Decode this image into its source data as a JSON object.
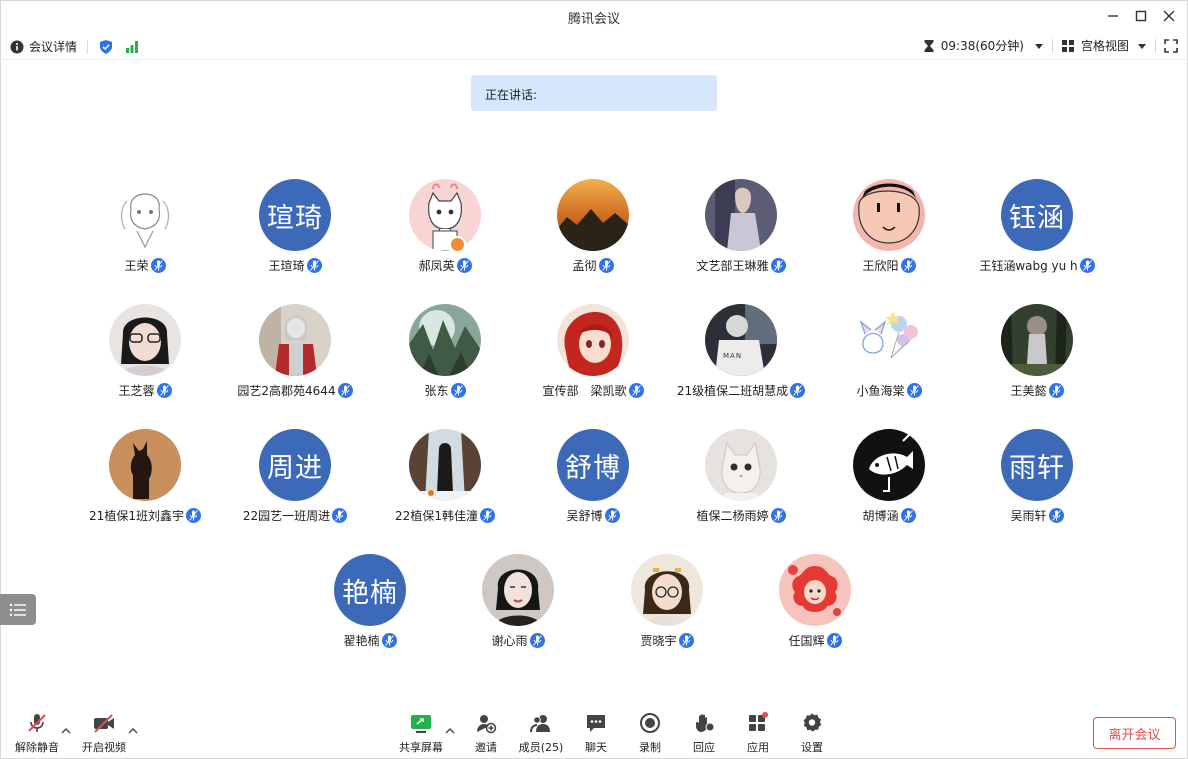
{
  "window": {
    "title": "腾讯会议"
  },
  "infobar": {
    "meeting_details": "会议详情",
    "timer": "09:38(60分钟)",
    "view_mode": "宫格视图"
  },
  "speaking": {
    "label": "正在讲话:"
  },
  "participants": [
    {
      "name": "王荣",
      "avatar_text": ""
    },
    {
      "name": "王瑄琦",
      "avatar_text": "瑄琦"
    },
    {
      "name": "郝凤英",
      "avatar_text": ""
    },
    {
      "name": "孟彻",
      "avatar_text": ""
    },
    {
      "name": "文艺部王琳雅",
      "avatar_text": ""
    },
    {
      "name": "王欣阳",
      "avatar_text": ""
    },
    {
      "name": "王钰涵wabg yu h",
      "avatar_text": "钰涵"
    },
    {
      "name": "王芝蓉",
      "avatar_text": ""
    },
    {
      "name": "园艺2高郡苑4644",
      "avatar_text": ""
    },
    {
      "name": "张东",
      "avatar_text": ""
    },
    {
      "name": "宣传部　梁凯歌",
      "avatar_text": ""
    },
    {
      "name": "21级植保二班胡慧成",
      "avatar_text": ""
    },
    {
      "name": "小鱼海棠",
      "avatar_text": ""
    },
    {
      "name": "王美懿",
      "avatar_text": ""
    },
    {
      "name": "21植保1班刘鑫宇",
      "avatar_text": ""
    },
    {
      "name": "22园艺一班周进",
      "avatar_text": "周进"
    },
    {
      "name": "22植保1韩佳潼",
      "avatar_text": ""
    },
    {
      "name": "吴舒博",
      "avatar_text": "舒博"
    },
    {
      "name": "植保二杨雨婷",
      "avatar_text": ""
    },
    {
      "name": "胡博涵",
      "avatar_text": ""
    },
    {
      "name": "吴雨轩",
      "avatar_text": "雨轩"
    },
    {
      "name": "翟艳楠",
      "avatar_text": "艳楠"
    },
    {
      "name": "谢心雨",
      "avatar_text": ""
    },
    {
      "name": "贾晓宇",
      "avatar_text": ""
    },
    {
      "name": "任国辉",
      "avatar_text": ""
    }
  ],
  "toolbar": {
    "unmute": "解除静音",
    "start_video": "开启视频",
    "share_screen": "共享屏幕",
    "invite": "邀请",
    "members": "成员(25)",
    "chat": "聊天",
    "record": "录制",
    "reactions": "回应",
    "apps": "应用",
    "settings": "设置",
    "leave": "离开会议"
  },
  "colors": {
    "accent": "#2f73e6",
    "avatar_text_bg": "#3d6ab8",
    "leave_red": "#e24e4e",
    "speaking_bg": "#d6e7fb"
  }
}
